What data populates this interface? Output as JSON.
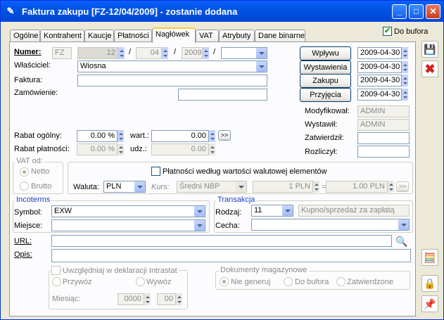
{
  "window": {
    "title": "Faktura zakupu [FZ-12/04/2009]  - zostanie dodana",
    "min": "_",
    "max": "□",
    "close": "✕"
  },
  "tabs": [
    "Ogólne",
    "Kontrahent",
    "Kaucje",
    "Płatności",
    "Nagłówek",
    "VAT",
    "Atrybuty",
    "Dane binarne"
  ],
  "do_bufora": "Do bufora",
  "numer": {
    "label": "Numer:",
    "prefix": "FZ",
    "nr": "12",
    "month": "04",
    "year": "2009",
    "slash": "/",
    "series": ""
  },
  "wlasciciel": {
    "label": "Właściciel:",
    "value": "Wiosna"
  },
  "faktura": {
    "label": "Faktura:",
    "value": ""
  },
  "zamowienie": {
    "label": "Zamówienie:",
    "value": ""
  },
  "dates": [
    {
      "label": "Wpływu",
      "value": "2009-04-30"
    },
    {
      "label": "Wystawienia",
      "value": "2009-04-30"
    },
    {
      "label": "Zakupu",
      "value": "2009-04-30"
    },
    {
      "label": "Przyjęcia",
      "value": "2009-04-30"
    }
  ],
  "meta": [
    {
      "label": "Modyfikował:",
      "value": "ADMIN"
    },
    {
      "label": "Wystawił:",
      "value": "ADMIN"
    },
    {
      "label": "Zatwierdził:",
      "value": ""
    },
    {
      "label": "Rozliczył:",
      "value": ""
    }
  ],
  "rabat_ogolny": {
    "label": "Rabat ogólny:",
    "pct": "0.00 %",
    "wart_label": "wart.:",
    "wart": "0.00",
    "more": ">>"
  },
  "rabat_platnosci": {
    "label": "Rabat płatności:",
    "pct": "0.00 %",
    "udz_label": "udz.:",
    "udz": "0.00"
  },
  "vat_od": {
    "title": "VAT od:",
    "netto": "Netto",
    "brutto": "Brutto"
  },
  "platnosci_check": "Płatności według wartości walutowej elementów",
  "waluta": {
    "label": "Waluta:",
    "value": "PLN",
    "kurs_label": "Kurs:",
    "kurs": "Średni NBP",
    "rate1": "1 PLN",
    "eq": "=",
    "rate2": "1.00 PLN",
    "more": ">>"
  },
  "incoterms": {
    "title": "Incoterms",
    "symbol_label": "Symbol:",
    "symbol": "EXW",
    "miejsce_label": "Miejsce:",
    "miejsce": ""
  },
  "transakcja": {
    "title": "Transakcja",
    "rodzaj_label": "Rodzaj:",
    "rodzaj": "11",
    "rodzaj_desc": "Kupno/sprzedaż za zapłatą",
    "cecha_label": "Cecha:",
    "cecha": ""
  },
  "url": {
    "label": "URL:",
    "value": ""
  },
  "opis": {
    "label": "Opis:",
    "value": ""
  },
  "intrastat": {
    "check": "Uwzględniaj w deklaracji Intrastat",
    "przywoz": "Przywóz",
    "wywoz": "Wywóz",
    "miesiac_label": "Miesiąc:",
    "year": "0000",
    "month": "00"
  },
  "dokumenty": {
    "title": "Dokumenty magazynowe",
    "opt1": "Nie generuj",
    "opt2": "Do bufora",
    "opt3": "Zatwierdzone"
  },
  "colors": {
    "titlebar": "#0054e3",
    "panel": "#fcfcfe",
    "window": "#ece9d8"
  }
}
